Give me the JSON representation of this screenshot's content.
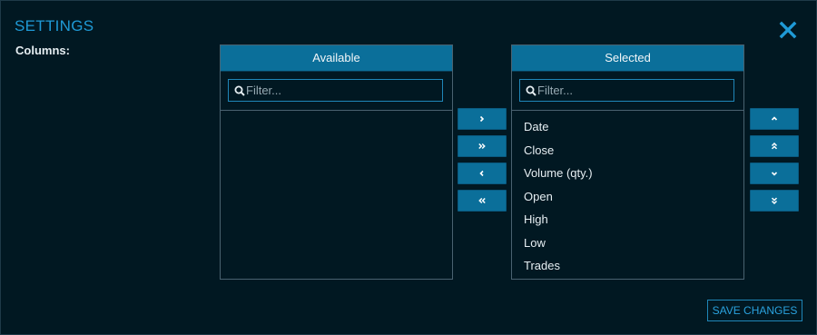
{
  "dialog": {
    "title": "SETTINGS"
  },
  "columns_label": "Columns:",
  "available": {
    "header": "Available",
    "filter_placeholder": "Filter...",
    "items": []
  },
  "selected": {
    "header": "Selected",
    "filter_placeholder": "Filter...",
    "items": [
      "Date",
      "Close",
      "Volume (qty.)",
      "Open",
      "High",
      "Low",
      "Trades"
    ]
  },
  "footer": {
    "save_label": "SAVE CHANGES"
  },
  "icons": {
    "close": "close-icon",
    "search": "search-icon",
    "move_right": "chevron-right-icon",
    "move_all_right": "double-chevron-right-icon",
    "move_left": "chevron-left-icon",
    "move_all_left": "double-chevron-left-icon",
    "move_up": "chevron-up-icon",
    "move_top": "double-chevron-up-icon",
    "move_down": "chevron-down-icon",
    "move_bottom": "double-chevron-down-icon"
  },
  "colors": {
    "background": "#011822",
    "accent": "#1f9ad6",
    "header": "#0b6f9a",
    "border": "#4a6270"
  }
}
